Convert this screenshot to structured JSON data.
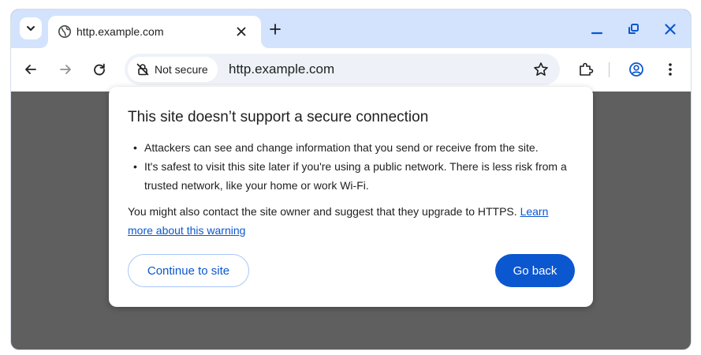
{
  "tab": {
    "title": "http.example.com",
    "favicon": "globe-icon"
  },
  "omnibox": {
    "security_label": "Not secure",
    "url": "http.example.com"
  },
  "dialog": {
    "title": "This site doesn’t support a secure connection",
    "bullets": [
      "Attackers can see and change information that you send or receive from the site.",
      "It's safest to visit this site later if you're using a public network. There is less risk from a trusted network, like your home or work Wi-Fi."
    ],
    "body_text": "You might also contact the site owner and suggest that they upgrade to HTTPS.",
    "learn_more_link": "Learn more about this warning",
    "continue_label": "Continue to site",
    "go_back_label": "Go back"
  },
  "colors": {
    "tabstrip_bg": "#d3e3fd",
    "accent": "#0b57d0",
    "page_bg": "#5f5f5f"
  }
}
